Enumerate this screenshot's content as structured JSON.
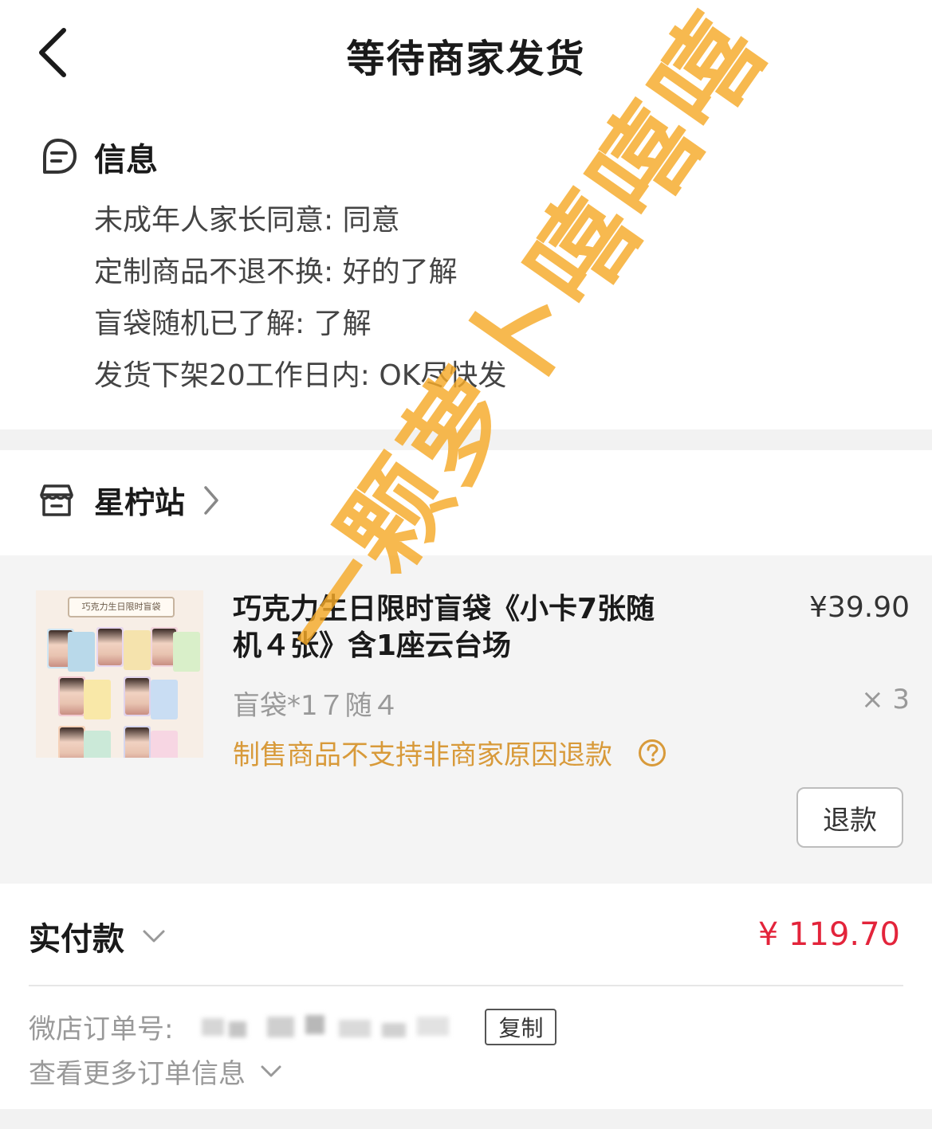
{
  "header": {
    "title": "等待商家发货"
  },
  "info": {
    "title": "信息",
    "lines": [
      "未成年人家长同意: 同意",
      "定制商品不退不换: 好的了解",
      "盲袋随机已了解: 了解",
      "发货下架20工作日内: OK尽快发"
    ]
  },
  "shop": {
    "name": "星柠站"
  },
  "product": {
    "thumb_banner": "巧克力生日限时盲袋",
    "title": "巧克力生日限时盲袋《小卡7张随机４张》含1座云台场",
    "price": "¥39.90",
    "spec": "盲袋*1７随４",
    "qty": "× 3",
    "notice": "制售商品不支持非商家原因退款",
    "refund_label": "退款"
  },
  "payment": {
    "label": "实付款",
    "amount": "¥ 119.70"
  },
  "order": {
    "label": "微店订单号:",
    "copy_label": "复制",
    "more_label": "查看更多订单信息"
  },
  "watermark": "一颗萝卜嘻嘻嘻",
  "colors": {
    "price_red": "#e3243b",
    "notice_orange": "#d89a3a",
    "watermark": "#f5aa28"
  }
}
